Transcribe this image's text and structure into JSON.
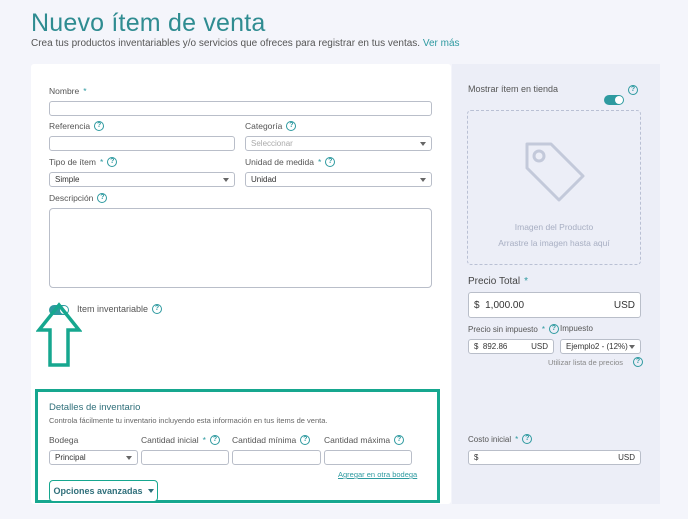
{
  "header": {
    "title": "Nuevo ítem de venta",
    "subtitle": "Crea tus productos inventariables y/o servicios que ofreces para registrar en tus ventas.",
    "more_link": "Ver más"
  },
  "form": {
    "nombre": {
      "label": "Nombre",
      "value": ""
    },
    "referencia": {
      "label": "Referencia",
      "value": ""
    },
    "categoria": {
      "label": "Categoría",
      "placeholder": "Seleccionar"
    },
    "tipo": {
      "label": "Tipo de ítem",
      "value": "Simple"
    },
    "unidad": {
      "label": "Unidad de medida",
      "value": "Unidad"
    },
    "descripcion": {
      "label": "Descripción",
      "value": ""
    },
    "inventariable": {
      "label": "Item inventariable",
      "on": true
    }
  },
  "inventory": {
    "title": "Detalles de inventario",
    "description": "Controla fácilmente tu inventario incluyendo esta información en tus ítems de venta.",
    "bodega": {
      "label": "Bodega",
      "value": "Principal"
    },
    "cantidad_inicial": {
      "label": "Cantidad inicial"
    },
    "cantidad_minima": {
      "label": "Cantidad mínima"
    },
    "cantidad_maxima": {
      "label": "Cantidad máxima"
    },
    "add_warehouse_link": "Agregar en otra bodega",
    "advanced_button": "Opciones avanzadas"
  },
  "side": {
    "show_in_store": {
      "label": "Mostrar ítem en tienda",
      "on": true
    },
    "image": {
      "title": "Imagen del Producto",
      "hint": "Arrastre la imagen hasta aquí"
    },
    "precio_total": {
      "label": "Precio Total",
      "currency_symbol": "$",
      "value": "1,000.00",
      "currency": "USD"
    },
    "precio_sin_impuesto": {
      "label": "Precio sin impuesto",
      "currency_symbol": "$",
      "value": "892.86",
      "currency": "USD"
    },
    "impuesto": {
      "label": "Impuesto",
      "value": "Ejemplo2 - (12%)"
    },
    "price_list_link": "Utilizar lista de precios",
    "costo_inicial": {
      "label": "Costo inicial",
      "currency_symbol": "$",
      "currency": "USD"
    }
  },
  "colors": {
    "accent": "#2e9aa0",
    "highlight": "#16a78f"
  },
  "required_mark": "*",
  "help_glyph": "?"
}
